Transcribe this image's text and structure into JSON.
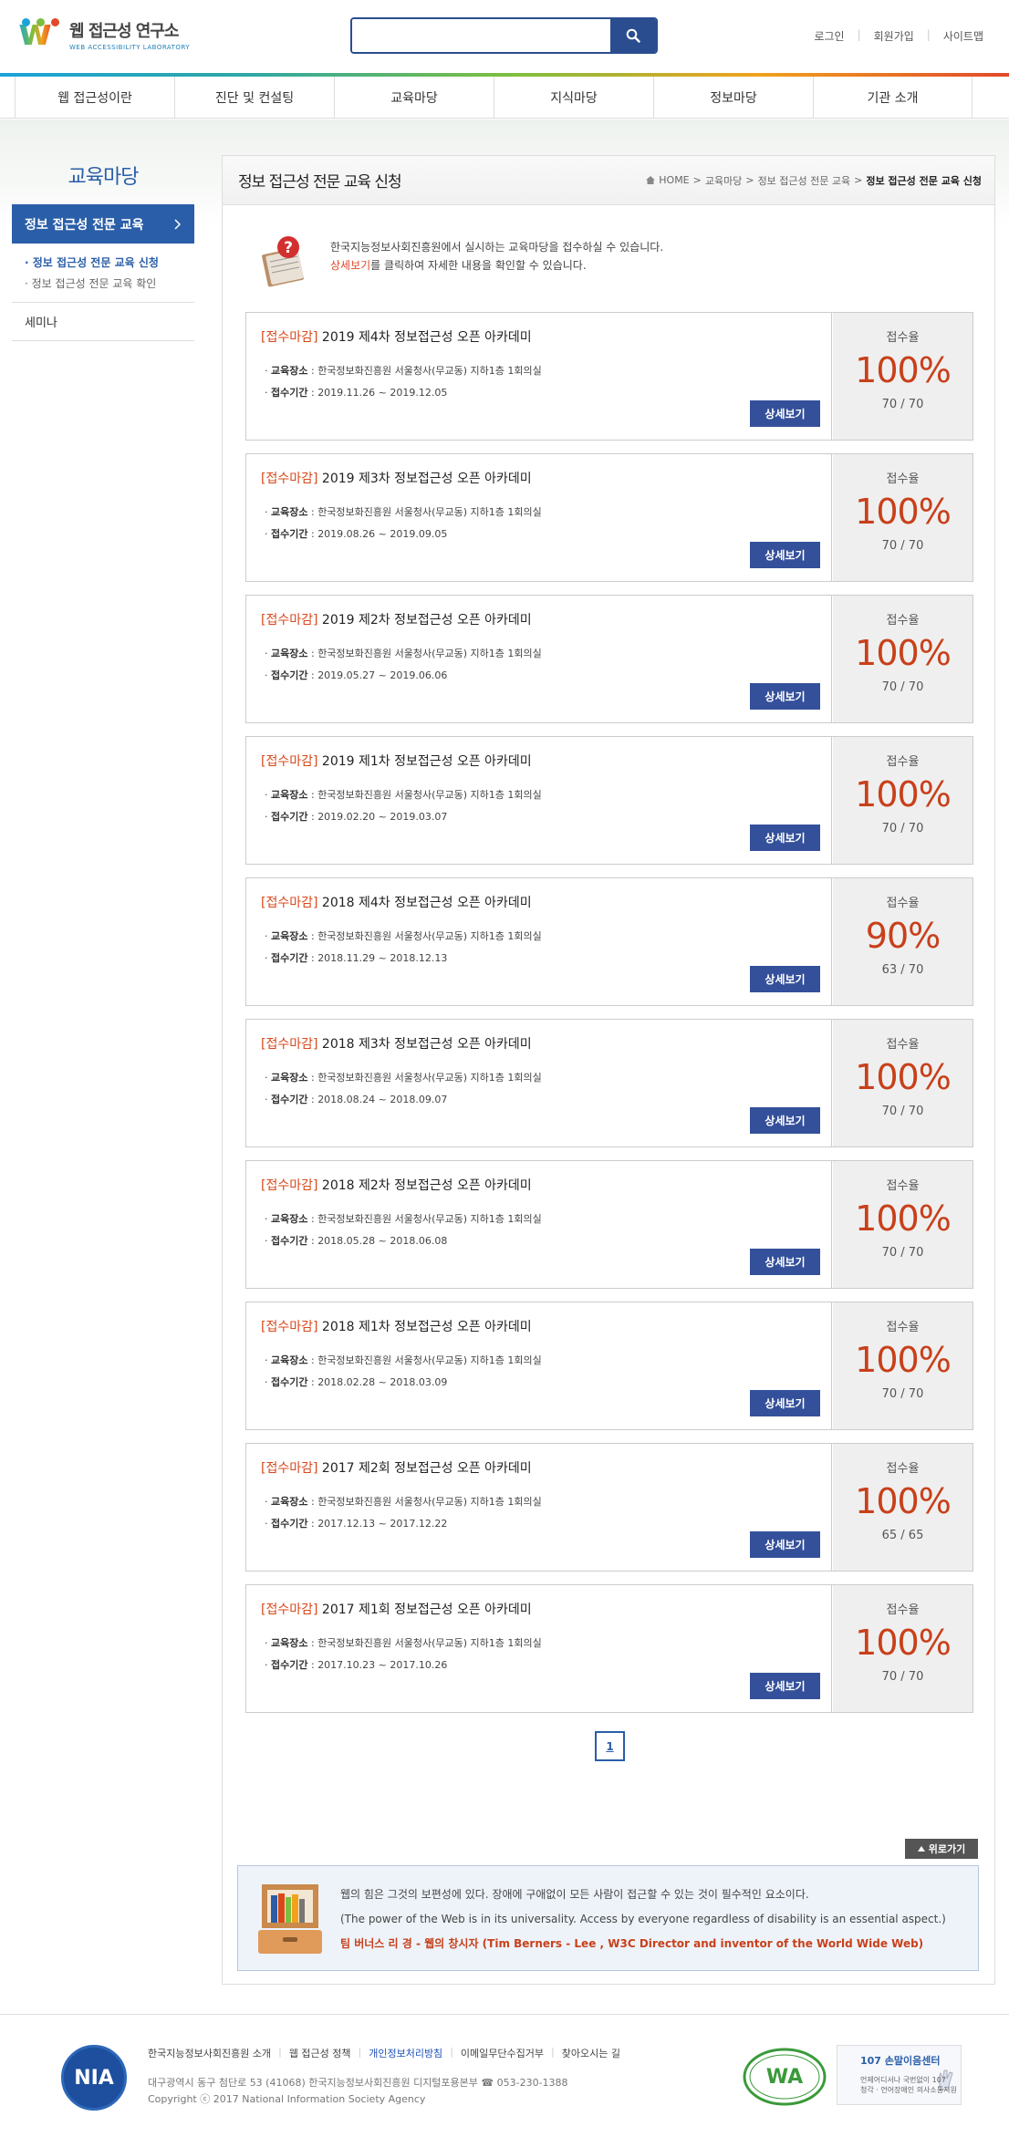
{
  "header": {
    "logo_title": "웹 접근성 연구소",
    "logo_sub": "WEB ACCESSIBILITY LABORATORY",
    "search_placeholder": "",
    "util_links": [
      "로그인",
      "회원가입",
      "사이트맵"
    ]
  },
  "gnb": [
    "웹 접근성이란",
    "진단 및 컨설팅",
    "교육마당",
    "지식마당",
    "정보마당",
    "기관 소개"
  ],
  "sidebar": {
    "title": "교육마당",
    "active": "정보 접근성 전문 교육",
    "sub_items": [
      "정보 접근성 전문 교육 신청",
      "정보 접근성 전문 교육 확인"
    ],
    "item": "세미나"
  },
  "content": {
    "title": "정보 접근성 전문 교육 신청",
    "breadcrumb": [
      "HOME",
      "교육마당",
      "정보 접근성 전문 교육",
      "정보 접근성 전문 교육 신청"
    ],
    "intro_line1": "한국지능정보사회진흥원에서 실시하는 교육마당을 접수하실 수 있습니다.",
    "intro_link": "상세보기",
    "intro_line2_rest": "를 클릭하여 자세한 내용을 확인할 수 있습니다.",
    "rate_label": "접수율",
    "place_label": "교육장소",
    "period_label": "접수기간",
    "detail_label": "상세보기",
    "cards": [
      {
        "status": "[접수마감]",
        "title": "2019 제4차 정보접근성 오픈 아카데미",
        "place": "한국정보화진흥원 서울청사(무교동) 지하1층 1회의실",
        "period": "2019.11.26 ~ 2019.12.05",
        "rate": "100%",
        "count": "70 / 70"
      },
      {
        "status": "[접수마감]",
        "title": "2019 제3차 정보접근성 오픈 아카데미",
        "place": "한국정보화진흥원 서울청사(무교동) 지하1층 1회의실",
        "period": "2019.08.26 ~ 2019.09.05",
        "rate": "100%",
        "count": "70 / 70"
      },
      {
        "status": "[접수마감]",
        "title": "2019 제2차 정보접근성 오픈 아카데미",
        "place": "한국정보화진흥원 서울청사(무교동) 지하1층 1회의실",
        "period": "2019.05.27 ~ 2019.06.06",
        "rate": "100%",
        "count": "70 / 70"
      },
      {
        "status": "[접수마감]",
        "title": "2019 제1차 정보접근성 오픈 아카데미",
        "place": "한국정보화진흥원 서울청사(무교동) 지하1층 1회의실",
        "period": "2019.02.20 ~ 2019.03.07",
        "rate": "100%",
        "count": "70 / 70"
      },
      {
        "status": "[접수마감]",
        "title": "2018 제4차 정보접근성 오픈 아카데미",
        "place": "한국정보화진흥원 서울청사(무교동) 지하1층 1회의실",
        "period": "2018.11.29 ~ 2018.12.13",
        "rate": "90%",
        "count": "63 / 70"
      },
      {
        "status": "[접수마감]",
        "title": "2018 제3차 정보접근성 오픈 아카데미",
        "place": "한국정보화진흥원 서울청사(무교동) 지하1층 1회의실",
        "period": "2018.08.24 ~ 2018.09.07",
        "rate": "100%",
        "count": "70 / 70"
      },
      {
        "status": "[접수마감]",
        "title": "2018 제2차 정보접근성 오픈 아카데미",
        "place": "한국정보화진흥원 서울청사(무교동) 지하1층 1회의실",
        "period": "2018.05.28 ~ 2018.06.08",
        "rate": "100%",
        "count": "70 / 70"
      },
      {
        "status": "[접수마감]",
        "title": "2018 제1차 정보접근성 오픈 아카데미",
        "place": "한국정보화진흥원 서울청사(무교동) 지하1층 1회의실",
        "period": "2018.02.28 ~ 2018.03.09",
        "rate": "100%",
        "count": "70 / 70"
      },
      {
        "status": "[접수마감]",
        "title": "2017 제2회 정보접근성 오픈 아카데미",
        "place": "한국정보화진흥원 서울청사(무교동) 지하1층 1회의실",
        "period": "2017.12.13 ~ 2017.12.22",
        "rate": "100%",
        "count": "65 / 65"
      },
      {
        "status": "[접수마감]",
        "title": "2017 제1회 정보접근성 오픈 아카데미",
        "place": "한국정보화진흥원 서울청사(무교동) 지하1층 1회의실",
        "period": "2017.10.23 ~ 2017.10.26",
        "rate": "100%",
        "count": "70 / 70"
      }
    ],
    "page": "1",
    "to_top": "위로가기",
    "quote_ko": "웹의 힘은 그것의 보편성에 있다. 장애에 구애없이 모든 사람이 접근할 수 있는 것이 필수적인 요소이다.",
    "quote_en": "(The power of the Web is in its universality. Access by everyone regardless of disability is an essential aspect.)",
    "quote_author": "팀 버너스 리 경 - 웹의 창시자 (Tim Berners - Lee , W3C Director and inventor of the World Wide Web)"
  },
  "footer": {
    "logo": "NIA",
    "links": [
      "한국지능정보사회진흥원 소개",
      "웹 접근성 정책",
      "개인정보처리방침",
      "이메일무단수집거부",
      "찾아오시는 길"
    ],
    "address": "대구광역시 동구 첨단로 53 (41068) 한국지능정보사회진흥원 디지털포용본부 ☎ 053-230-1388",
    "copyright": "Copyright ⓒ 2017 National Information Society Agency",
    "center_title": "107 손말이음센터",
    "center_sub1": "언제어디서나 국번없이 107",
    "center_sub2": "청각 · 언어장애인 의사소통지원"
  },
  "colors": {
    "primary": "#2a5ea8",
    "accent": "#c8401a",
    "button": "#34509a"
  }
}
